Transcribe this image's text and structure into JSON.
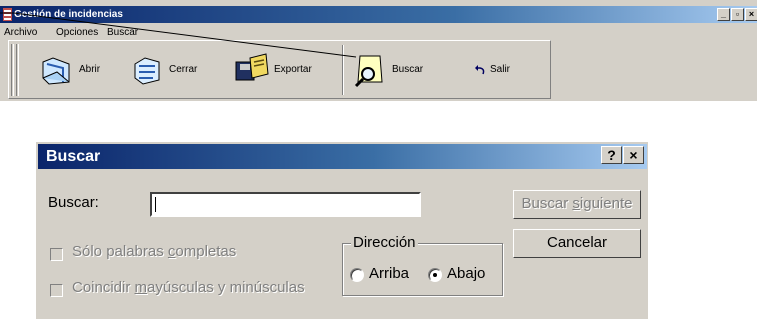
{
  "app": {
    "title": "Gestión de incidencias",
    "menu": [
      "Archivo",
      "Opciones",
      "Buscar"
    ],
    "toolbar": [
      {
        "label": "Abrir",
        "icon": "open-folder-icon"
      },
      {
        "label": "Cerrar",
        "icon": "close-folder-icon"
      },
      {
        "label": "Exportar",
        "icon": "export-disk-icon"
      },
      {
        "label": "Buscar",
        "icon": "magnifier-icon"
      },
      {
        "label": "Salir",
        "icon": "undo-arrow-icon"
      }
    ],
    "controls": {
      "minimize": "_",
      "restore": "▫",
      "close": "×"
    }
  },
  "dialog": {
    "title": "Buscar",
    "help": "?",
    "close": "×",
    "search_label": "Buscar:",
    "search_value": "",
    "whole_words": {
      "before": "Sólo palabras ",
      "mnemonic": "c",
      "after": "ompletas",
      "checked": false
    },
    "match_case": {
      "before": "Coincidir ",
      "mnemonic": "m",
      "after": "ayúsculas y minúsculas",
      "checked": false
    },
    "find_next": {
      "before": "Buscar ",
      "mnemonic": "s",
      "after": "iguiente"
    },
    "cancel": "Cancelar",
    "direction": {
      "legend": "Dirección",
      "options": [
        "Arriba",
        "Abajo"
      ],
      "selected": "Abajo"
    }
  }
}
